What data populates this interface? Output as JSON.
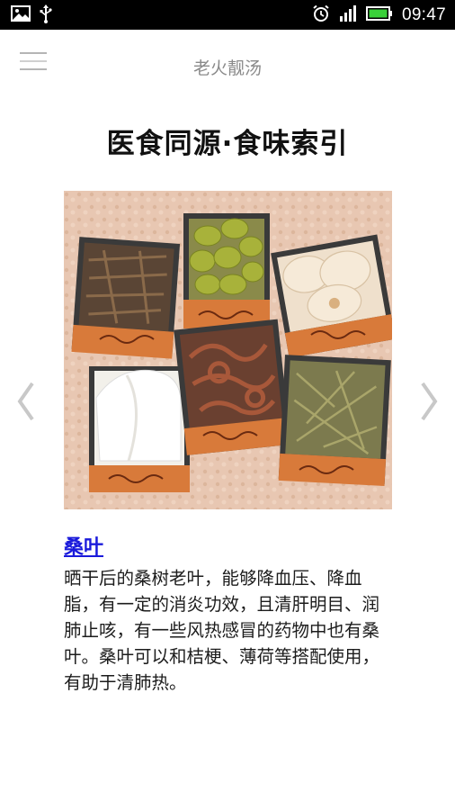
{
  "status_bar": {
    "time": "09:47",
    "icons": [
      "image-icon",
      "usb-icon",
      "alarm-icon",
      "signal-icon",
      "battery-icon"
    ]
  },
  "app_bar": {
    "title": "老火靓汤",
    "menu_icon": "hamburger-menu-icon"
  },
  "page": {
    "heading": "医食同源·食味索引"
  },
  "carousel": {
    "prev_icon": "chevron-left-icon",
    "next_icon": "chevron-right-icon"
  },
  "item": {
    "title": "桑叶",
    "description": "晒干后的桑树老叶，能够降血压、降血脂，有一定的消炎功效，且清肝明目、润肺止咳，有一些风热感冒的药物中也有桑叶。桑叶可以和桔梗、薄荷等搭配使用，有助于清肺热。"
  },
  "colors": {
    "link": "#1a1adb",
    "status_bar_bg": "#000000",
    "battery": "#3ad13a"
  }
}
